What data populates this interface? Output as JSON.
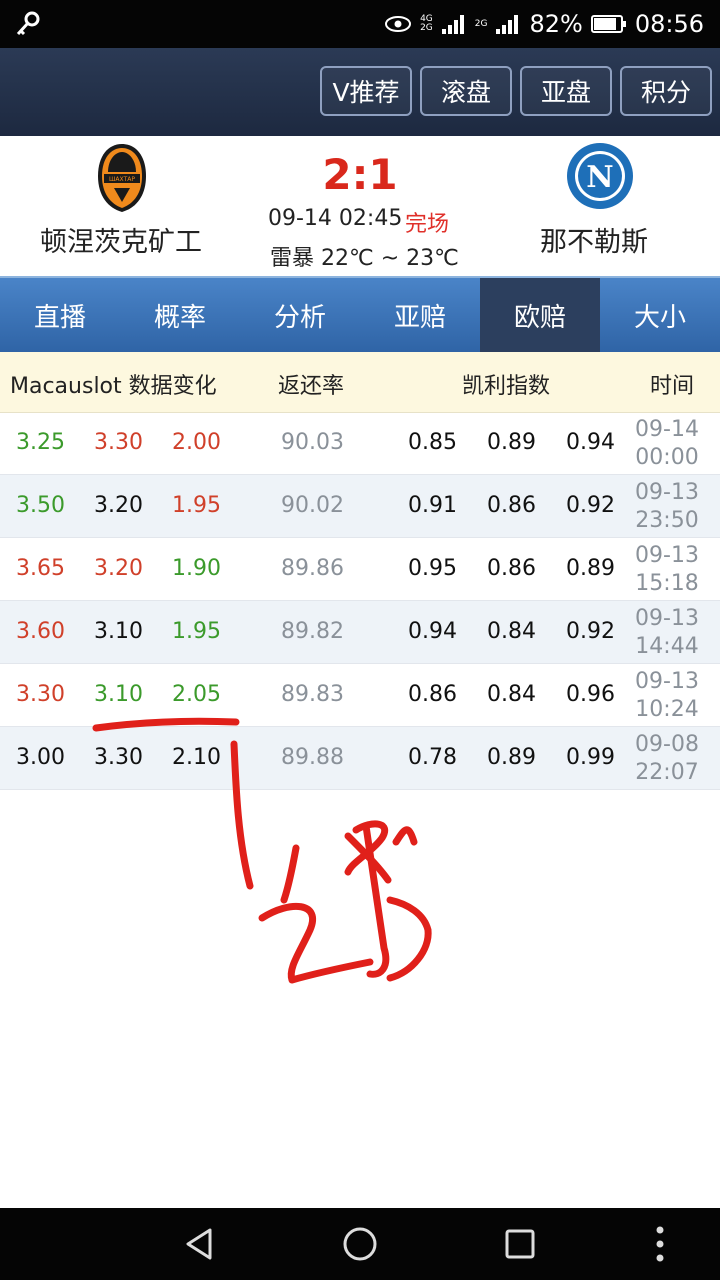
{
  "status_bar": {
    "network_top": "4G",
    "network_bottom": "2G",
    "network2": "2G",
    "battery": "82%",
    "time": "08:56"
  },
  "top_nav": {
    "buttons": [
      "V推荐",
      "滚盘",
      "亚盘",
      "积分"
    ]
  },
  "match": {
    "home_team": "顿涅茨克矿工",
    "away_team": "那不勒斯",
    "home_logo_text": "ШАХТАР",
    "away_logo_text": "N",
    "score": "2:1",
    "datetime": "09-14 02:45",
    "status": "完场",
    "weather": "雷暴  22℃ ~ 23℃"
  },
  "tabs": [
    "直播",
    "概率",
    "分析",
    "亚赔",
    "欧赔",
    "大小"
  ],
  "active_tab": "欧赔",
  "table": {
    "headers": {
      "bookmaker": "Macauslot 数据变化",
      "return_rate": "返还率",
      "kelly": "凯利指数",
      "time": "时间"
    },
    "rows": [
      {
        "home": "3.25",
        "draw": "3.30",
        "away": "2.00",
        "ret": "90.03",
        "k1": "0.85",
        "k2": "0.89",
        "k3": "0.94",
        "date": "09-14",
        "clock": "00:00"
      },
      {
        "home": "3.50",
        "draw": "3.20",
        "away": "1.95",
        "ret": "90.02",
        "k1": "0.91",
        "k2": "0.86",
        "k3": "0.92",
        "date": "09-13",
        "clock": "23:50"
      },
      {
        "home": "3.65",
        "draw": "3.20",
        "away": "1.90",
        "ret": "89.86",
        "k1": "0.95",
        "k2": "0.86",
        "k3": "0.89",
        "date": "09-13",
        "clock": "15:18"
      },
      {
        "home": "3.60",
        "draw": "3.10",
        "away": "1.95",
        "ret": "89.82",
        "k1": "0.94",
        "k2": "0.84",
        "k3": "0.92",
        "date": "09-13",
        "clock": "14:44"
      },
      {
        "home": "3.30",
        "draw": "3.10",
        "away": "2.05",
        "ret": "89.83",
        "k1": "0.86",
        "k2": "0.84",
        "k3": "0.96",
        "date": "09-13",
        "clock": "10:24"
      },
      {
        "home": "3.00",
        "draw": "3.30",
        "away": "2.10",
        "ret": "89.88",
        "k1": "0.78",
        "k2": "0.89",
        "k3": "0.99",
        "date": "09-08",
        "clock": "22:07"
      }
    ]
  },
  "colors": {
    "up": "#3b9a2b",
    "down": "#d0402a",
    "unchanged": "#111111",
    "score": "#d9281c",
    "annotation": "#e0201a"
  }
}
